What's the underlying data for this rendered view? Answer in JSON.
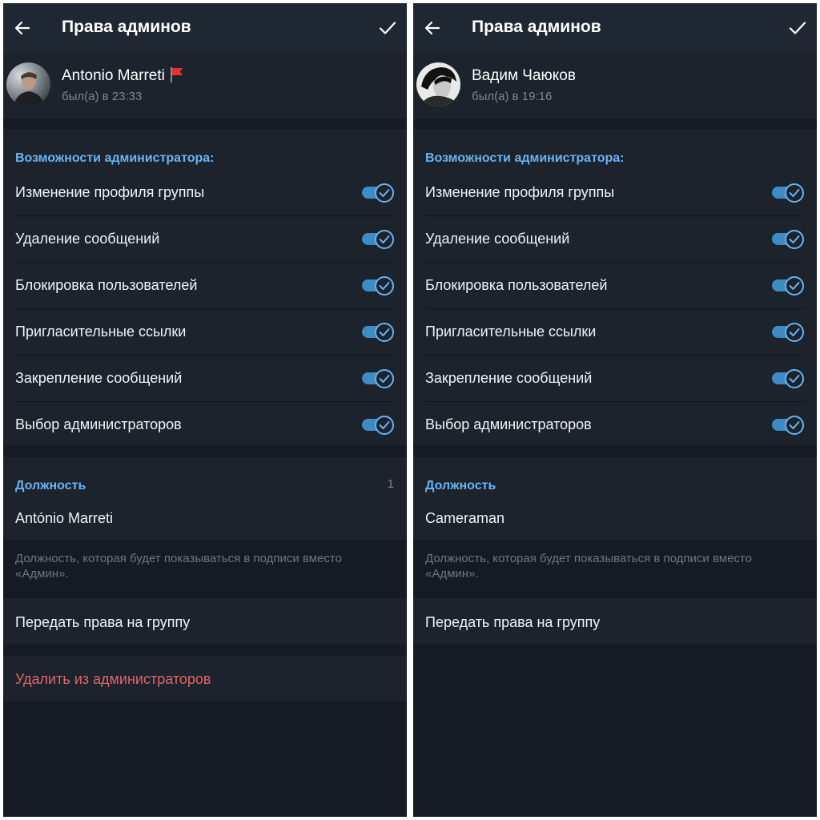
{
  "panels": [
    {
      "header": {
        "title": "Права админов"
      },
      "user": {
        "name": "Antonio Marreti",
        "status": "был(а) в 23:33",
        "flag_icon": "red-flag-icon",
        "has_flag": true
      },
      "admin_rights": {
        "header": "Возможности администратора:",
        "items": [
          {
            "label": "Изменение профиля группы",
            "enabled": true
          },
          {
            "label": "Удаление сообщений",
            "enabled": true
          },
          {
            "label": "Блокировка пользователей",
            "enabled": true
          },
          {
            "label": "Пригласительные ссылки",
            "enabled": true
          },
          {
            "label": "Закрепление сообщений",
            "enabled": true
          },
          {
            "label": "Выбор администраторов",
            "enabled": true
          }
        ]
      },
      "position": {
        "header": "Должность",
        "counter": "1",
        "value": "António Marreti",
        "hint": "Должность, которая будет показываться в подписи вместо «Админ»."
      },
      "transfer_label": "Передать права на группу",
      "remove_label": "Удалить из администраторов"
    },
    {
      "header": {
        "title": "Права админов"
      },
      "user": {
        "name": "Вадим Чаюков",
        "status": "был(а) в 19:16"
      },
      "admin_rights": {
        "header": "Возможности администратора:",
        "items": [
          {
            "label": "Изменение профиля группы",
            "enabled": true
          },
          {
            "label": "Удаление сообщений",
            "enabled": true
          },
          {
            "label": "Блокировка пользователей",
            "enabled": true
          },
          {
            "label": "Пригласительные ссылки",
            "enabled": true
          },
          {
            "label": "Закрепление сообщений",
            "enabled": true
          },
          {
            "label": "Выбор администраторов",
            "enabled": true
          }
        ]
      },
      "position": {
        "header": "Должность",
        "value": "Cameraman",
        "hint": "Должность, которая будет показываться в подписи вместо «Админ»."
      },
      "transfer_label": "Передать права на группу"
    }
  ],
  "colors": {
    "background": "#151b22",
    "surface": "#1c232d",
    "appbar": "#1e2732",
    "accent": "#6ab3f3",
    "toggle_track": "#3e8cc4",
    "destructive": "#e36368",
    "secondary_text": "#7c8793"
  }
}
